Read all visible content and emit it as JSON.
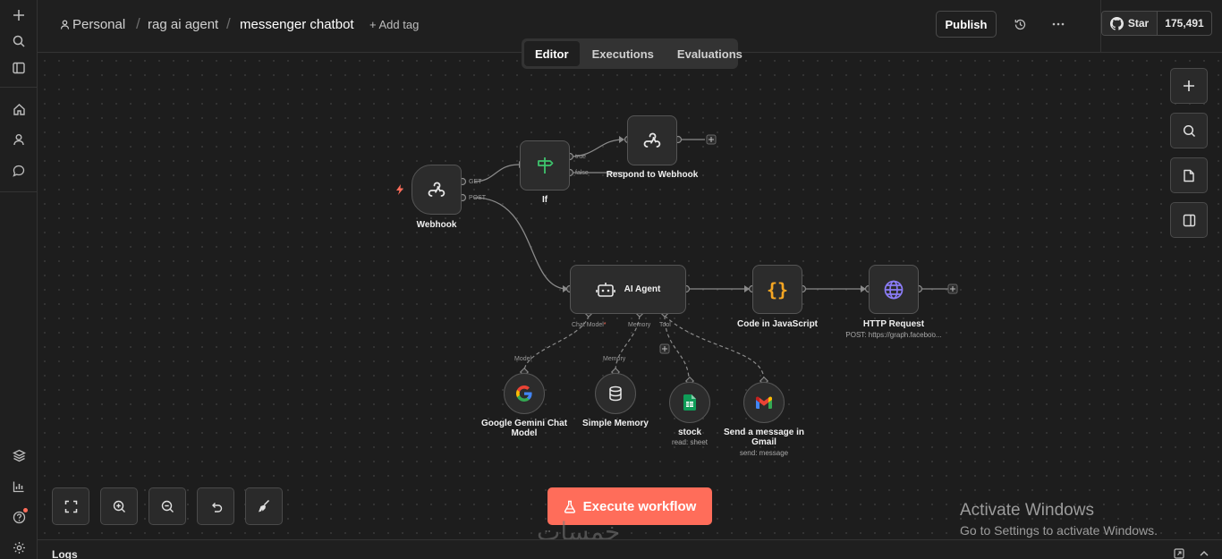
{
  "header": {
    "breadcrumb": [
      "Personal",
      "rag ai agent",
      "messenger chatbot"
    ],
    "add_tag": "+ Add tag",
    "publish": "Publish",
    "github_star": "Star",
    "github_count": "175,491"
  },
  "tabs": [
    "Editor",
    "Executions",
    "Evaluations"
  ],
  "active_tab": "Editor",
  "nodes": {
    "webhook": {
      "label": "Webhook",
      "outputs": [
        "GET",
        "POST"
      ]
    },
    "if": {
      "label": "If",
      "outputs": [
        "true",
        "false"
      ]
    },
    "respond": {
      "label": "Respond to Webhook"
    },
    "agent": {
      "label": "AI Agent",
      "ports": [
        "Chat Model",
        "Memory",
        "Tool"
      ]
    },
    "code": {
      "label": "Code in JavaScript"
    },
    "http": {
      "label": "HTTP Request",
      "sub": "POST: https://graph.faceboo..."
    },
    "gemini": {
      "label": "Google Gemini Chat Model",
      "port": "Model"
    },
    "memory": {
      "label": "Simple Memory",
      "port": "Memory"
    },
    "stock": {
      "label": "stock",
      "sub": "read: sheet"
    },
    "gmail": {
      "label": "Send a message in Gmail",
      "sub": "send: message"
    }
  },
  "execute_label": "Execute workflow",
  "logs_label": "Logs",
  "activate": {
    "title": "Activate Windows",
    "subtitle": "Go to Settings to activate Windows."
  },
  "watermark": "خمسات",
  "colors": {
    "accent": "#ff6d5a",
    "canvas": "#1d1d1d",
    "node": "#2c2c2c",
    "if_icon": "#3ec46d",
    "code_icon": "#f5a623",
    "http_icon": "#8b7cf6"
  }
}
